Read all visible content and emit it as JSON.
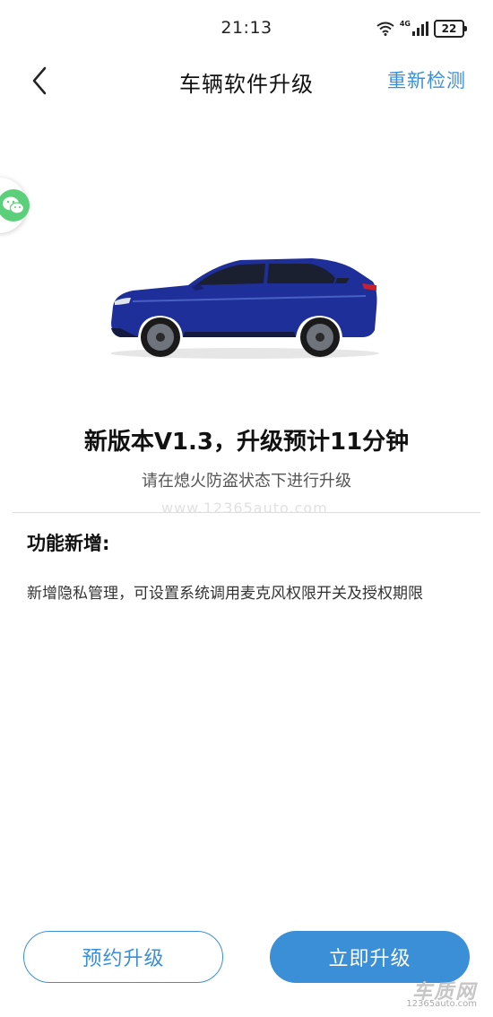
{
  "status_bar": {
    "time": "21:13",
    "network_label": "4G",
    "battery": "22",
    "icons": [
      "wifi-icon",
      "signal-icon",
      "battery-icon"
    ]
  },
  "nav": {
    "back_icon": "chevron-left-icon",
    "title": "车辆软件升级",
    "recheck_label": "重新检测"
  },
  "side_float": {
    "icon": "wechat-icon"
  },
  "vehicle": {
    "image": "blue-suv-side-view"
  },
  "update": {
    "title": "新版本V1.3，升级预计11分钟",
    "subtitle": "请在熄火防盗状态下进行升级"
  },
  "watermark": {
    "text": "www.12365auto.com"
  },
  "features": {
    "heading": "功能新增:",
    "description": "新增隐私管理，可设置系统调用麦克风权限开关及授权期限"
  },
  "actions": {
    "schedule_label": "预约升级",
    "upgrade_now_label": "立即升级"
  },
  "corner_logo": {
    "main": "车质网",
    "sub": "12365auto.com"
  },
  "colors": {
    "accent": "#3a8fd6",
    "car_body": "#1f2f9a"
  }
}
